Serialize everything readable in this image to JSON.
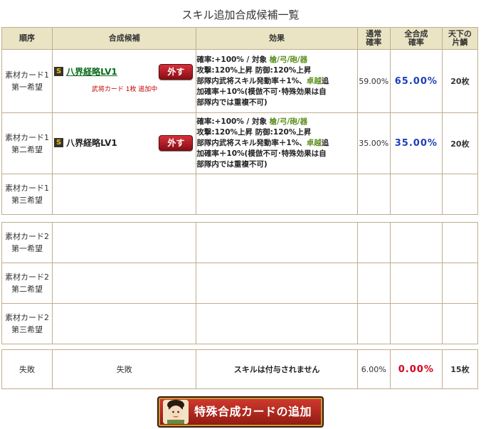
{
  "page": {
    "title": "スキル追加合成候補一覧"
  },
  "headers": {
    "order": "順序",
    "candidate": "合成候補",
    "effect": "効果",
    "normal_rate_l1": "通常",
    "normal_rate_l2": "確率",
    "total_rate_l1": "全合成",
    "total_rate_l2": "確率",
    "tenka_l1": "天下の",
    "tenka_l2": "片鱗"
  },
  "rows": [
    {
      "order_l1": "素材カード1",
      "order_l2": "第一希望",
      "skill": "八界経略LV1",
      "remove": "外す",
      "in_use": "武将カード 1枚 追加中",
      "effect": {
        "a": "確率:+100% / 対象 ",
        "b": "槍/弓/砲/器",
        "c": "攻撃:120%上昇 防御:120%上昇",
        "d": "部隊内武将スキル発動率＋1%、",
        "e": "卓越",
        "f": "追",
        "g": "加確率＋10%(模倣不可･特殊効果は自",
        "h": "部隊内では重複不可)"
      },
      "normal_rate": "59.00%",
      "total_rate": "65.00%",
      "tenka": "20枚"
    },
    {
      "order_l1": "素材カード1",
      "order_l2": "第二希望",
      "skill": "八界経略LV1",
      "remove": "外す",
      "effect": {
        "a": "確率:+100% / 対象 ",
        "b": "槍/弓/砲/器",
        "c": "攻撃:120%上昇 防御:120%上昇",
        "d": "部隊内武将スキル発動率＋1%、",
        "e": "卓越",
        "f": "追",
        "g": "加確率＋10%(模倣不可･特殊効果は自",
        "h": "部隊内では重複不可)"
      },
      "normal_rate": "35.00%",
      "total_rate": "35.00%",
      "tenka": "20枚"
    },
    {
      "order_l1": "素材カード1",
      "order_l2": "第三希望"
    },
    {
      "order_l1": "素材カード2",
      "order_l2": "第一希望"
    },
    {
      "order_l1": "素材カード2",
      "order_l2": "第二希望"
    },
    {
      "order_l1": "素材カード2",
      "order_l2": "第三希望"
    }
  ],
  "fail": {
    "order": "失敗",
    "candidate": "失敗",
    "effect": "スキルは付与されません",
    "normal_rate": "6.00%",
    "total_rate": "0.00%",
    "tenka": "15枚"
  },
  "add_button": {
    "label": "特殊合成カードの追加"
  },
  "colors": {
    "header_bg": "#eae3c4",
    "border": "#bfae8e",
    "rate_blue": "#1d3fb8",
    "rate_red": "#d4001a",
    "target_green": "#5a8f1c"
  }
}
